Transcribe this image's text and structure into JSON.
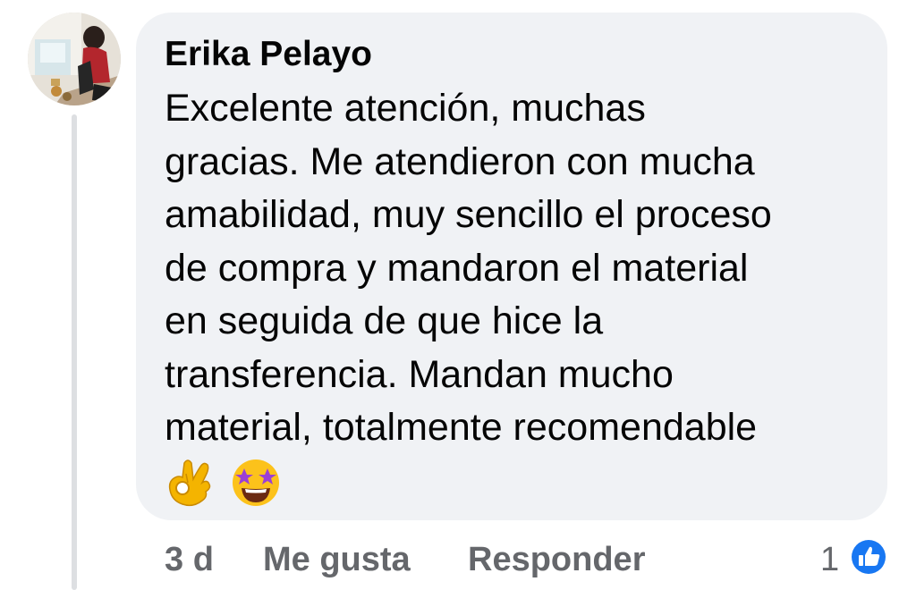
{
  "comment": {
    "author": "Erika Pelayo",
    "text_lines": [
      "Excelente atención, muchas",
      "gracias.  Me atendieron con mucha",
      "amabilidad, muy sencillo el proceso",
      "de compra y mandaron el material",
      "en seguida de que hice la",
      "transferencia. Mandan mucho",
      "material, totalmente recomendable"
    ],
    "emojis": [
      "ok-hand-icon",
      "star-struck-icon"
    ]
  },
  "actions": {
    "time": "3 d",
    "like_label": "Me gusta",
    "reply_label": "Responder"
  },
  "reactions": {
    "count": "1",
    "icon": "like-icon",
    "badge_color": "#1877f2"
  },
  "colors": {
    "bubble": "#f0f2f5",
    "text": "#050505",
    "secondary_text": "#65676b"
  }
}
